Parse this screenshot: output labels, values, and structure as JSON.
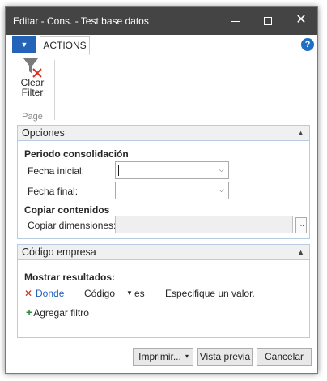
{
  "window": {
    "title": "Editar - Cons. - Test base datos",
    "controls": {
      "minimize": "minimize-icon",
      "maximize": "maximize-icon",
      "close": "✕"
    }
  },
  "ribbon": {
    "app_menu_icon": "▼",
    "tab_label": "ACTIONS",
    "help_icon": "?",
    "clear_filter_line1": "Clear",
    "clear_filter_line2": "Filter",
    "group_label": "Page"
  },
  "options": {
    "header": "Opciones",
    "period_title": "Periodo consolidación",
    "fecha_inicial_label": "Fecha inicial:",
    "fecha_inicial_value": "",
    "fecha_final_label": "Fecha final:",
    "fecha_final_value": "",
    "copy_title": "Copiar contenidos",
    "copiar_dimensiones_label": "Copiar dimensiones:",
    "copiar_dimensiones_value": "",
    "lookup_label": "..."
  },
  "company": {
    "header": "Código empresa",
    "show_results_title": "Mostrar resultados:",
    "filter_remove_icon": "✕",
    "filter_where": "Donde",
    "filter_field": "Código",
    "filter_op": "es",
    "filter_value_placeholder": "Especifique un valor.",
    "add_filter_label": "Agregar filtro",
    "add_filter_icon": "+"
  },
  "footer": {
    "print_label": "Imprimir...",
    "preview_label": "Vista previa",
    "cancel_label": "Cancelar"
  },
  "colors": {
    "titlebar": "#444444",
    "accent_blue": "#2563b8",
    "remove_red": "#c42b1c",
    "add_green": "#2e8b3e"
  }
}
